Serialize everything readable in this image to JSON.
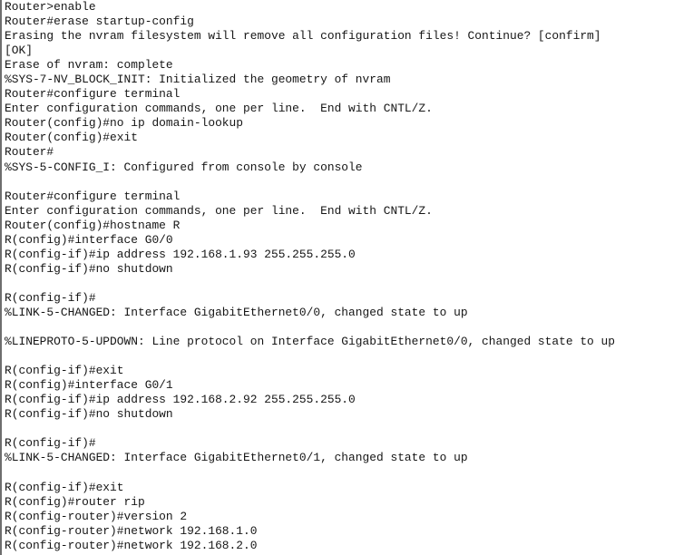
{
  "terminal": {
    "device_prompt_initial": "Router",
    "device_prompt_renamed": "R",
    "background_color": "#ffffff",
    "text_color": "#161616",
    "border_color": "#6e6e6e",
    "lines": [
      "Router>enable",
      "Router#erase startup-config",
      "Erasing the nvram filesystem will remove all configuration files! Continue? [confirm]",
      "[OK]",
      "Erase of nvram: complete",
      "%SYS-7-NV_BLOCK_INIT: Initialized the geometry of nvram",
      "Router#configure terminal",
      "Enter configuration commands, one per line.  End with CNTL/Z.",
      "Router(config)#no ip domain-lookup",
      "Router(config)#exit",
      "Router#",
      "%SYS-5-CONFIG_I: Configured from console by console",
      "",
      "Router#configure terminal",
      "Enter configuration commands, one per line.  End with CNTL/Z.",
      "Router(config)#hostname R",
      "R(config)#interface G0/0",
      "R(config-if)#ip address 192.168.1.93 255.255.255.0",
      "R(config-if)#no shutdown",
      "",
      "R(config-if)#",
      "%LINK-5-CHANGED: Interface GigabitEthernet0/0, changed state to up",
      "",
      "%LINEPROTO-5-UPDOWN: Line protocol on Interface GigabitEthernet0/0, changed state to up",
      "",
      "R(config-if)#exit",
      "R(config)#interface G0/1",
      "R(config-if)#ip address 192.168.2.92 255.255.255.0",
      "R(config-if)#no shutdown",
      "",
      "R(config-if)#",
      "%LINK-5-CHANGED: Interface GigabitEthernet0/1, changed state to up",
      "",
      "R(config-if)#exit",
      "R(config)#router rip",
      "R(config-router)#version 2",
      "R(config-router)#network 192.168.1.0",
      "R(config-router)#network 192.168.2.0"
    ]
  }
}
